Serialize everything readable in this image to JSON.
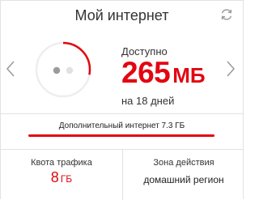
{
  "header": {
    "title": "Мой интернет",
    "refresh_icon": "refresh-icon"
  },
  "nav": {
    "prev_icon": "chevron-left-icon",
    "next_icon": "chevron-right-icon"
  },
  "gauge": {
    "remaining_fraction": 0.28,
    "accent_color": "#e30611",
    "track_color": "#eeeeee",
    "dots": [
      "active",
      "inactive"
    ]
  },
  "balance": {
    "label": "Доступно",
    "amount": "265",
    "unit": "МБ",
    "period": "на 18 дней"
  },
  "extra": {
    "label": "Дополнительный интернет 7.3 ГБ",
    "fill_fraction": 1.0
  },
  "quota": {
    "label": "Квота трафика",
    "value": "8",
    "unit": "ГБ"
  },
  "zone": {
    "label": "Зона действия",
    "value": "домашний регион"
  },
  "colors": {
    "accent": "#e30611",
    "border": "#e2e2e2"
  }
}
